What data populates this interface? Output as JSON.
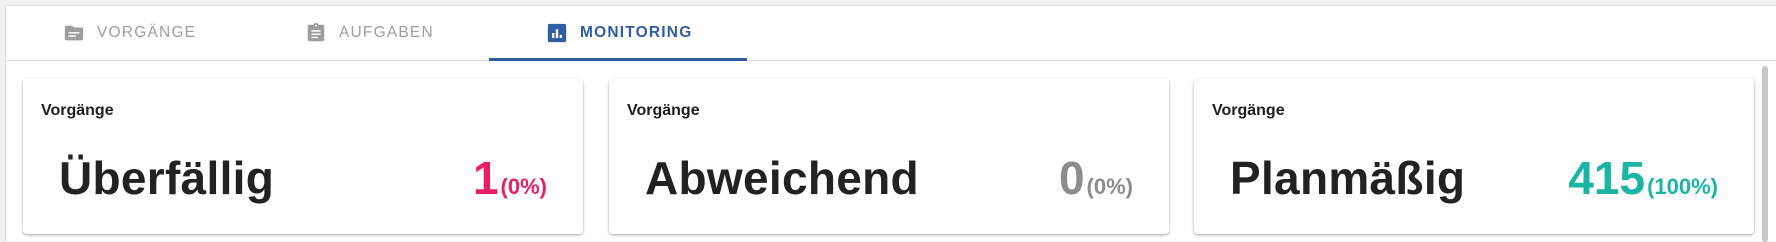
{
  "tabs": [
    {
      "label": "VORGÄNGE",
      "icon": "folder-icon",
      "active": false
    },
    {
      "label": "AUFGABEN",
      "icon": "clipboard-icon",
      "active": false
    },
    {
      "label": "MONITORING",
      "icon": "bar-chart-icon",
      "active": true
    }
  ],
  "colors": {
    "accent": "#2f5ea3",
    "overdue": "#e91e63",
    "deviating": "#8c8c8c",
    "on_schedule": "#1ab5a5"
  },
  "cards": [
    {
      "label": "Vorgänge",
      "title": "Überfällig",
      "value": "1",
      "percent": "(0%)"
    },
    {
      "label": "Vorgänge",
      "title": "Abweichend",
      "value": "0",
      "percent": "(0%)"
    },
    {
      "label": "Vorgänge",
      "title": "Planmäßig",
      "value": "415",
      "percent": "(100%)"
    }
  ]
}
